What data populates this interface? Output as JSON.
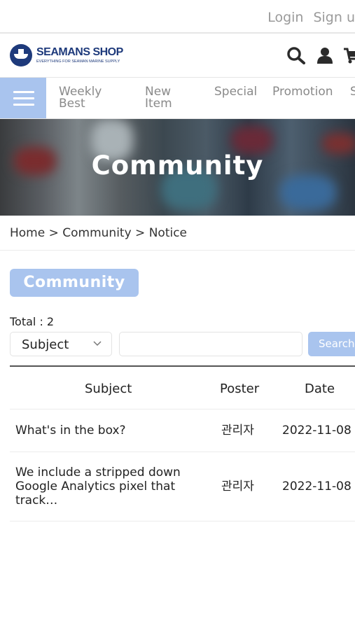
{
  "top_links": {
    "login": "Login",
    "signup": "Sign u"
  },
  "logo": {
    "brand": "SEAMANS SHOP",
    "tagline": "EVERYTHING FOR SEAMAN MARINE SUPPLY"
  },
  "header_icons": [
    "search-icon",
    "user-icon",
    "cart-icon"
  ],
  "nav": {
    "items": [
      {
        "line1": "Weekly",
        "line2": "Best"
      },
      {
        "line1": "New",
        "line2": "Item"
      },
      {
        "line1": "Special",
        "line2": ""
      },
      {
        "line1": "Promotion",
        "line2": ""
      },
      {
        "line1": "S",
        "line2": ""
      }
    ]
  },
  "hero": {
    "title": "Community"
  },
  "breadcrumb": "Home > Community > Notice",
  "section_badge": "Community",
  "total": "Total : 2",
  "search": {
    "select_value": "Subject",
    "input_value": "",
    "button": "Search"
  },
  "table": {
    "headers": {
      "subject": "Subject",
      "poster": "Poster",
      "date": "Date"
    },
    "rows": [
      {
        "subject": "What's in the box?",
        "poster": "관리자",
        "date": "2022-11-08"
      },
      {
        "subject_line1": "We include a stripped down",
        "subject_line2": "Google Analytics pixel that",
        "subject_line3": "track…",
        "poster": "관리자",
        "date": "2022-11-08"
      }
    ]
  },
  "colors": {
    "accent": "#a9c4ee",
    "brand": "#1e3a7b"
  }
}
